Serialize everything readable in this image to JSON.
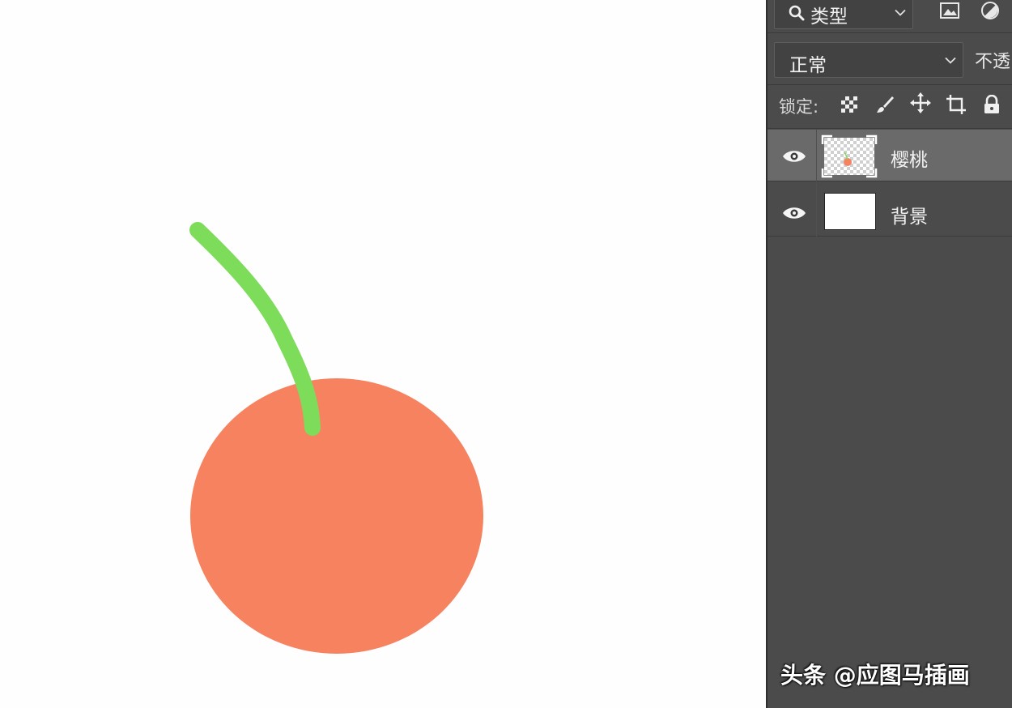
{
  "canvas": {
    "illustration": "cherry",
    "colors": {
      "cherry_fill": "#f6825f",
      "stem": "#7ddc5a",
      "background": "#fefefe"
    }
  },
  "layers_panel": {
    "filter": {
      "search_icon": "search-icon",
      "type_label": "类型"
    },
    "blend_mode": {
      "value": "正常"
    },
    "opacity_label": "不透",
    "lock": {
      "label": "锁定:"
    },
    "layers": [
      {
        "name": "樱桃",
        "visible": true,
        "selected": true
      },
      {
        "name": "背景",
        "visible": true,
        "selected": false
      }
    ],
    "colors": {
      "panel_bg": "#4b4b4b",
      "selected_row": "#6a6a6a"
    }
  },
  "watermark": {
    "text": "头条 @应图马插画"
  }
}
